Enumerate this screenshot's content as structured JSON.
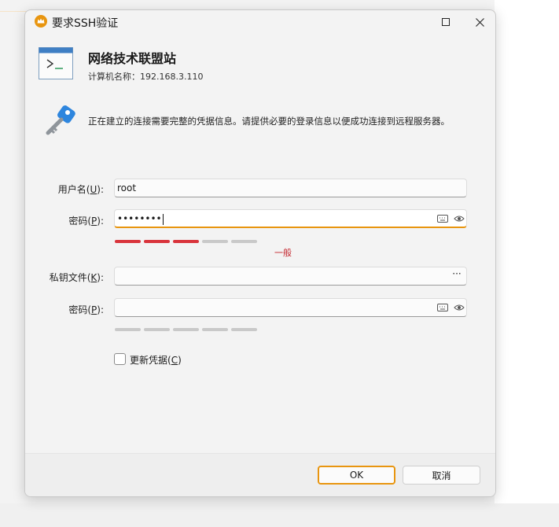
{
  "window": {
    "title": "要求SSH验证",
    "maximize_icon": "maximize-icon",
    "close_icon": "close-icon"
  },
  "header": {
    "app_name": "网络技术联盟站",
    "computer_label": "计算机名称：",
    "computer_value": "192.168.3.110"
  },
  "info": {
    "message": "正在建立的连接需要完整的凭据信息。请提供必要的登录信息以便成功连接到远程服务器。"
  },
  "form": {
    "username": {
      "label": "用户名",
      "mnemonic": "U",
      "value": "root"
    },
    "password": {
      "label": "密码",
      "mnemonic": "P",
      "value": "••••••••",
      "strength_filled": 3,
      "strength_total": 5,
      "strength_text": "一般"
    },
    "private_key": {
      "label": "私钥文件",
      "mnemonic": "K",
      "value": "",
      "browse": "···"
    },
    "key_password": {
      "label": "密码",
      "mnemonic": "P",
      "value": "",
      "strength_filled": 0,
      "strength_total": 5
    },
    "update_credentials": {
      "label": "更新凭据",
      "mnemonic": "C",
      "checked": false
    }
  },
  "buttons": {
    "ok": "OK",
    "cancel": "取消"
  },
  "colors": {
    "accent": "#e8950f",
    "strength_weak": "#d9343c"
  }
}
